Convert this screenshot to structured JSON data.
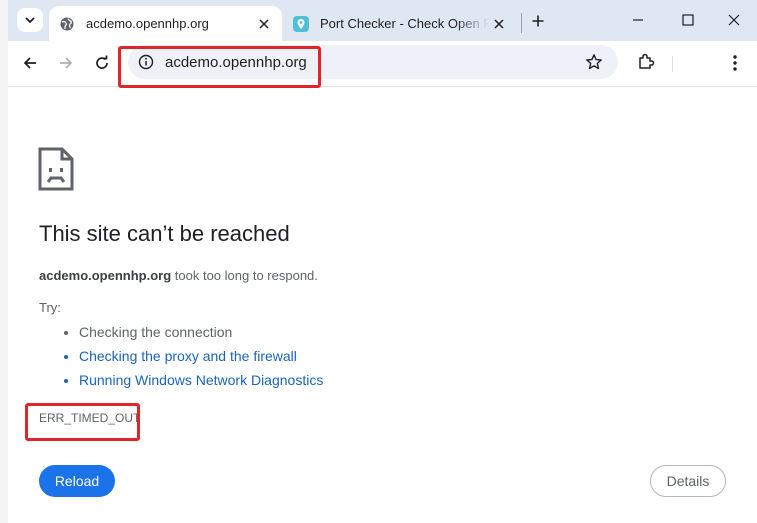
{
  "browser": {
    "tabs": [
      {
        "title": "acdemo.opennhp.org",
        "active": true,
        "favicon": "globe-icon"
      },
      {
        "title": "Port Checker - Check Open Ports",
        "active": false,
        "favicon": "location-pin-icon"
      }
    ],
    "address": "acdemo.opennhp.org"
  },
  "error": {
    "heading": "This site can’t be reached",
    "host": "acdemo.opennhp.org",
    "message": " took too long to respond.",
    "try_label": "Try:",
    "suggestions": [
      {
        "text": "Checking the connection",
        "link": false
      },
      {
        "text": "Checking the proxy and the firewall",
        "link": true
      },
      {
        "text": "Running Windows Network Diagnostics",
        "link": true
      }
    ],
    "code": "ERR_TIMED_OUT"
  },
  "buttons": {
    "reload": "Reload",
    "details": "Details"
  },
  "colors": {
    "highlight": "#e0262a",
    "accent": "#1a73e8",
    "link": "#1a65b8"
  }
}
